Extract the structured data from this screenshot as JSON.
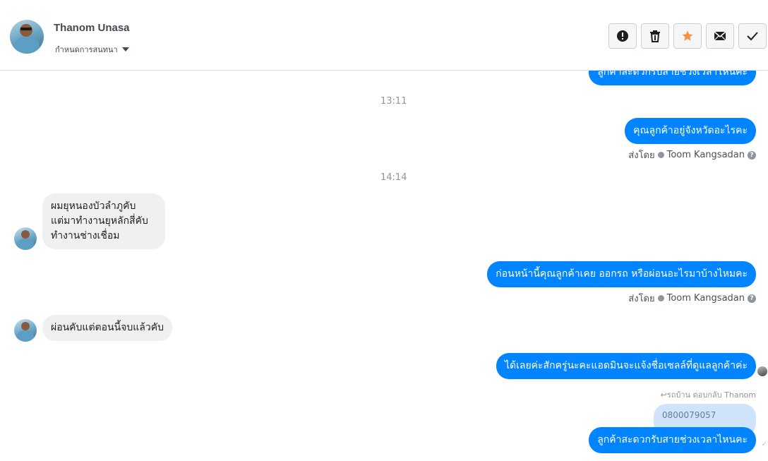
{
  "header": {
    "contact_name": "Thanom Unasa",
    "conversation_label": "กำหนดการสนทนา",
    "actions": [
      {
        "name": "report",
        "icon": "exclamation-circle-icon"
      },
      {
        "name": "delete",
        "icon": "trash-icon"
      },
      {
        "name": "star",
        "icon": "star-icon",
        "color": "#f7923b"
      },
      {
        "name": "mark-unread",
        "icon": "envelope-icon"
      },
      {
        "name": "done",
        "icon": "checkmark-icon"
      }
    ]
  },
  "thread": {
    "top_partial_message": "ลูกค้าสะดวกรับสายช่วงเวลาไหนคะ",
    "timestamp_1": "13:11",
    "msg_1": "คุณลูกค้าอยู่จังหวัดอะไรคะ",
    "sent_by_label_1": "ส่งโดย",
    "sender_1": "Toom Kangsadan",
    "timestamp_2": "14:14",
    "msg_2": "ผมยุหนองบัวลำภูคับ\nแต่มาทำงานยุหลักสี่คับ\nทำงานช่างเชื่อม",
    "msg_3": "ก่อนหน้านี้คุณลูกค้าเคย ออกรถ หรือผ่อนอะไรมาบ้างไหมคะ",
    "sent_by_label_2": "ส่งโดย",
    "sender_2": "Toom Kangsadan",
    "msg_4": "ผ่อนคับแต่ตอนนี้จบแล้วคับ",
    "msg_5": "ได้เลยค่ะสักครู่นะคะแอดมินจะแจ้งชื่อเซลล์ที่ดูแลลูกค้าค่ะ",
    "reply_note": "รถบ้าน ตอบกลับ Thanom",
    "quoted_message": "0800079057",
    "msg_6": "ลูกค้าสะดวกรับสายช่วงเวลาไหนคะ"
  },
  "colors": {
    "outgoing_bubble": "#0084ff",
    "incoming_bubble": "#f1f0f0",
    "quoted_bubble": "#cfe4fb",
    "star_accent": "#f7923b"
  }
}
